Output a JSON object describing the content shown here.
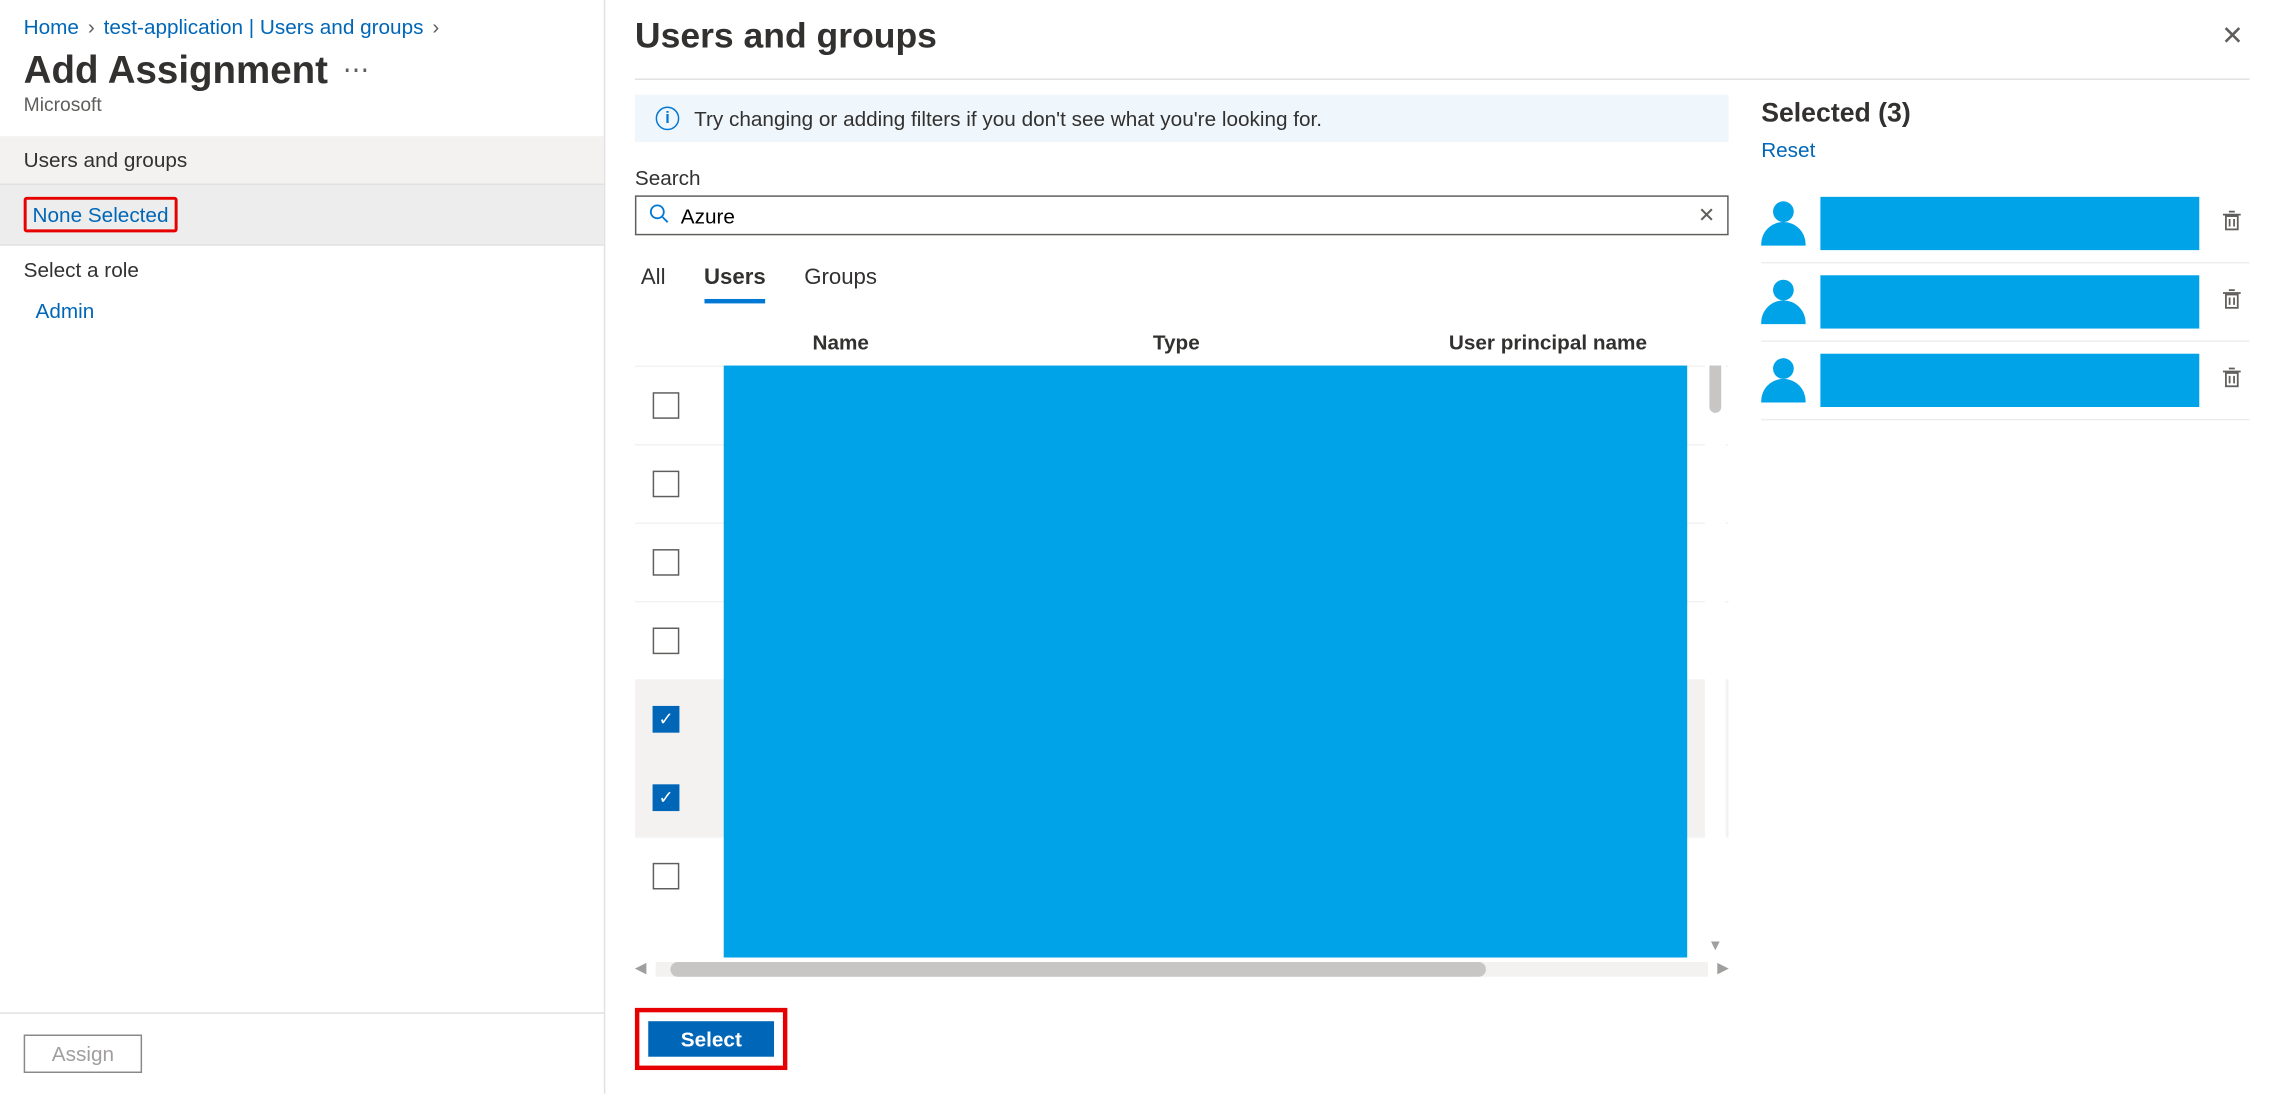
{
  "breadcrumb": {
    "home": "Home",
    "app": "test-application | Users and groups"
  },
  "page": {
    "title": "Add Assignment",
    "subtitle": "Microsoft"
  },
  "left": {
    "users_groups_label": "Users and groups",
    "none_selected": "None Selected",
    "select_role_label": "Select a role",
    "admin": "Admin",
    "assign_label": "Assign"
  },
  "panel": {
    "title": "Users and groups",
    "info": "Try changing or adding filters if you don't see what you're looking for.",
    "search_label": "Search",
    "search_value": "Azure",
    "tabs": {
      "all": "All",
      "users": "Users",
      "groups": "Groups",
      "active": "users"
    },
    "columns": {
      "name": "Name",
      "type": "Type",
      "upn": "User principal name"
    },
    "rows": [
      {
        "checked": false
      },
      {
        "checked": false
      },
      {
        "checked": false
      },
      {
        "checked": false
      },
      {
        "checked": true
      },
      {
        "checked": true
      },
      {
        "checked": false
      }
    ],
    "select_button": "Select"
  },
  "selected": {
    "title": "Selected (3)",
    "reset": "Reset",
    "count": 3
  }
}
